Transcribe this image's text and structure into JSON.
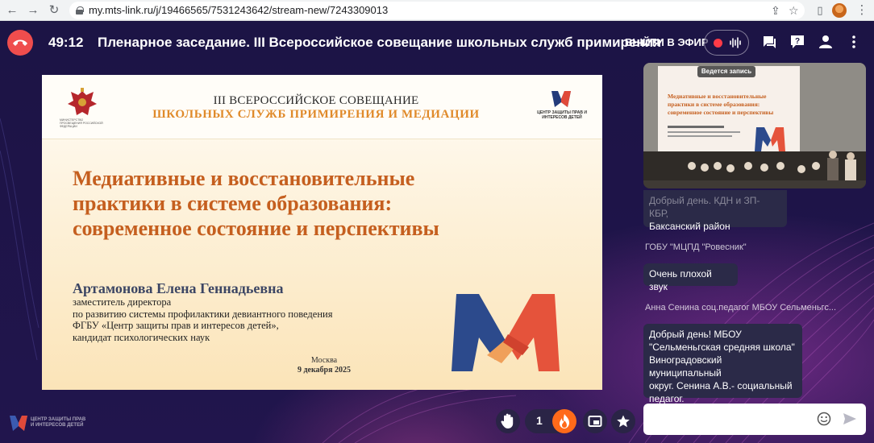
{
  "browser": {
    "url": "my.mts-link.ru/j/19466565/7531243642/stream-new/7243309013"
  },
  "topbar": {
    "timer": "49:12",
    "title": "Пленарное заседание. III Всероссийское совещание школьных служб примирения",
    "go_on_air": "ВЫЙТИ В ЭФИР"
  },
  "slide": {
    "ministry_caption": "МИНИСТЕРСТВО ПРОСВЕЩЕНИЯ РОССИЙСКОЙ ФЕДЕРАЦИИ",
    "header_line1": "III ВСЕРОССИЙСКОЕ СОВЕЩАНИЕ",
    "header_line2": "ШКОЛЬНЫХ СЛУЖБ ПРИМИРЕНИЯ И МЕДИАЦИИ",
    "center_caption": "ЦЕНТР ЗАЩИТЫ ПРАВ И ИНТЕРЕСОВ ДЕТЕЙ",
    "heading_l1": "Медиативные и восстановительные",
    "heading_l2": "практики в системе образования:",
    "heading_l3": "современное состояние и перспективы",
    "speaker": "Артамонова Елена Геннадьевна",
    "position_l1": "заместитель директора",
    "position_l2": "по развитию системы профилактики девиантного поведения",
    "position_l3": "ФГБУ «Центр защиты прав и интересов детей»,",
    "position_l4": "кандидат психологических наук",
    "city": "Москва",
    "date": "9 декабря 2025"
  },
  "video": {
    "recording_badge": "Ведется запись"
  },
  "chat": {
    "messages": [
      {
        "sender": "",
        "text_l1": "Добрый день. КДН и ЗП- КБР,",
        "text_l2": "Баксанский район"
      },
      {
        "sender": "ГОБУ \"МЦПД \"Ровесник\"",
        "text_l1": "Очень плохой звук"
      },
      {
        "sender": "Анна Сенина соц.педагог МБОУ Сельменьгс...",
        "text_l1": "Добрый день! МБОУ",
        "text_l2": "\"Сельменьгская средняя школа\"",
        "text_l3": "Виноградовский муниципальный",
        "text_l4": "округ. Сенина А.В.- социальный",
        "text_l5": "педагог."
      }
    ],
    "input_placeholder": ""
  },
  "bottom": {
    "org_caption": "ЦЕНТР ЗАЩИТЫ ПРАВ И ИНТЕРЕСОВ ДЕТЕЙ",
    "reaction_count": "1"
  },
  "colors": {
    "leave": "#ef4d4d",
    "record": "#ff3b47",
    "slide_accent": "#c55f1f",
    "reaction": "#ff6a1a"
  }
}
